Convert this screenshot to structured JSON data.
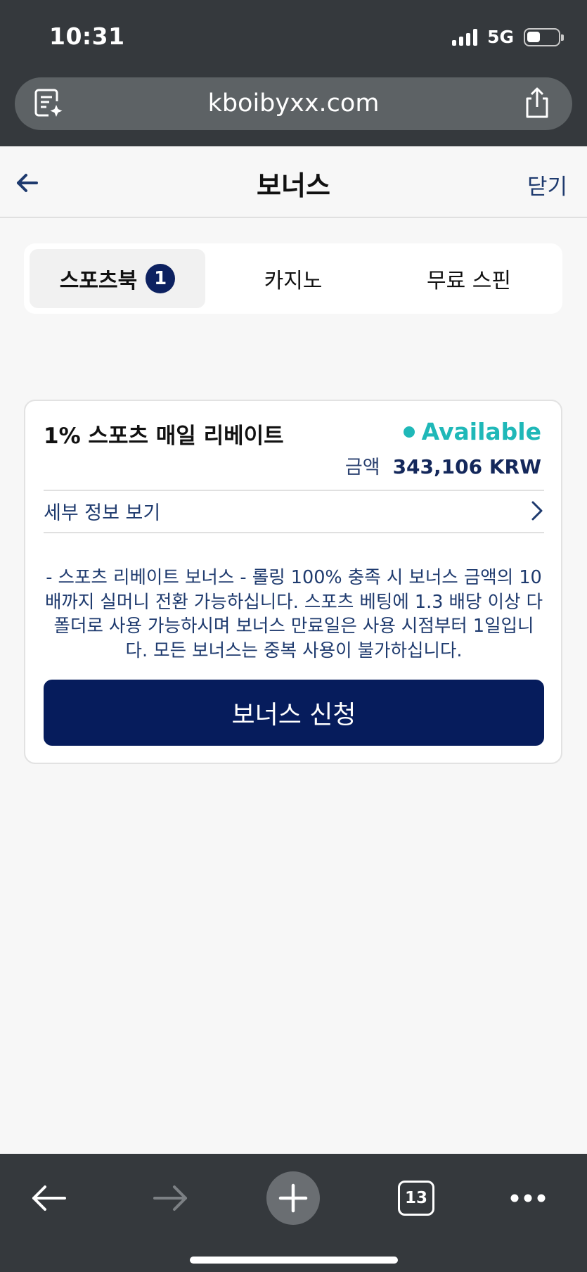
{
  "status_bar": {
    "time": "10:31",
    "network": "5G",
    "battery_level": 0.45
  },
  "browser": {
    "url": "kboibyxx.com",
    "tab_count": "13"
  },
  "header": {
    "title": "보너스",
    "close_label": "닫기"
  },
  "tabs": [
    {
      "label": "스포츠북",
      "badge": "1",
      "active": true
    },
    {
      "label": "카지노",
      "active": false
    },
    {
      "label": "무료 스핀",
      "active": false
    }
  ],
  "bonus_card": {
    "title": "1% 스포츠 매일 리베이트",
    "status": "Available",
    "status_color": "#1fb8b8",
    "amount_label": "금액",
    "amount_value": "343,106 KRW",
    "details_label": "세부 정보 보기",
    "description": "- 스포츠 리베이트 보너스 - 롤링 100% 충족 시 보너스 금액의 10배까지 실머니 전환 가능하십니다. 스포츠 베팅에 1.3 배당 이상 다폴더로 사용 가능하시며 보너스 만료일은 사용 시점부터 1일입니다. 모든 보너스는 중복 사용이 불가하십니다.",
    "apply_label": "보너스 신청",
    "button_color": "#061c5c"
  }
}
